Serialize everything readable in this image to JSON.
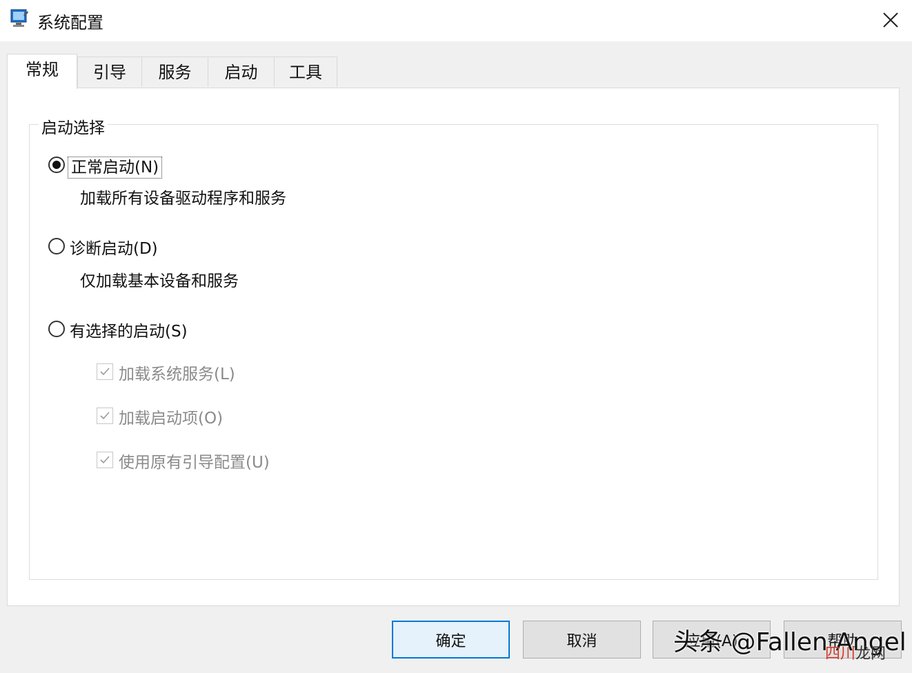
{
  "window": {
    "title": "系统配置",
    "close_icon": "close-icon"
  },
  "tabs": [
    {
      "label": "常规",
      "active": true
    },
    {
      "label": "引导",
      "active": false
    },
    {
      "label": "服务",
      "active": false
    },
    {
      "label": "启动",
      "active": false
    },
    {
      "label": "工具",
      "active": false
    }
  ],
  "startup_selection": {
    "group_label": "启动选择",
    "options": [
      {
        "label": "正常启动(N)",
        "description": "加载所有设备驱动程序和服务",
        "checked": true
      },
      {
        "label": "诊断启动(D)",
        "description": "仅加载基本设备和服务",
        "checked": false
      },
      {
        "label": "有选择的启动(S)",
        "checked": false
      }
    ],
    "sub_options": [
      {
        "label": "加载系统服务(L)",
        "checked": true,
        "enabled": false
      },
      {
        "label": "加载启动项(O)",
        "checked": true,
        "enabled": false
      },
      {
        "label": "使用原有引导配置(U)",
        "checked": true,
        "enabled": false
      }
    ]
  },
  "buttons": {
    "ok": "确定",
    "cancel": "取消",
    "apply": "应用(A)",
    "help": "帮助"
  },
  "watermark": {
    "text": "头条 @Fallen Angel",
    "site_a": "四川",
    "site_b": "龙网"
  }
}
